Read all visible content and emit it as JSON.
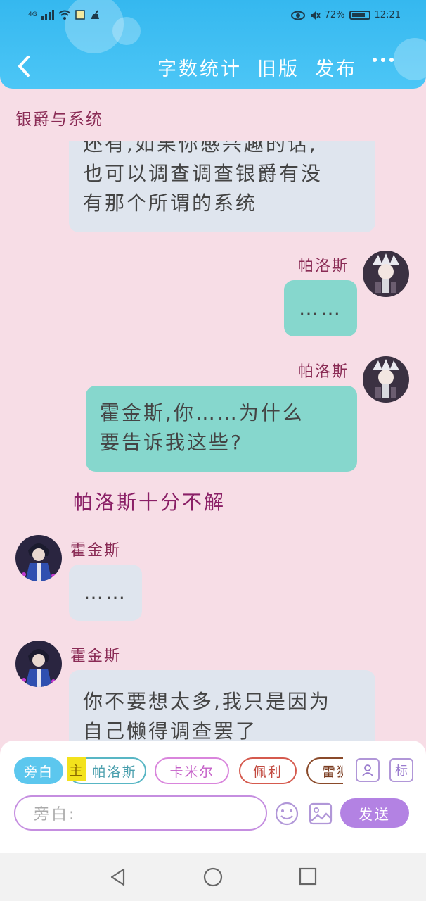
{
  "status_bar": {
    "network": "4G",
    "battery_percent": "72%",
    "time": "12:21"
  },
  "nav": {
    "actions": [
      "字数统计",
      "旧版",
      "发布"
    ]
  },
  "chat": {
    "title": "银爵与系统",
    "messages": [
      {
        "side": "left",
        "lines": [
          "还有,如果你感兴趣的话,",
          "也可以调查调查银爵有没",
          "有那个所谓的系统"
        ]
      },
      {
        "side": "right",
        "sender": "帕洛斯",
        "lines": [
          "……"
        ]
      },
      {
        "side": "right",
        "sender": "帕洛斯",
        "lines": [
          "霍金斯,你……为什么",
          "要告诉我这些?"
        ]
      },
      {
        "side": "narration",
        "text": "帕洛斯十分不解"
      },
      {
        "side": "left",
        "sender": "霍金斯",
        "lines": [
          "……"
        ]
      },
      {
        "side": "left",
        "sender": "霍金斯",
        "lines": [
          "你不要想太多,我只是因为",
          "自己懒得调查罢了"
        ]
      }
    ]
  },
  "panel": {
    "chips": {
      "narration": "旁白",
      "main_mark": "主",
      "c1": "帕洛斯",
      "c2": "卡米尔",
      "c3": "佩利",
      "c4": "雷狮"
    },
    "tag_icon_label": "标",
    "input_placeholder": "旁白:",
    "send_label": "发送"
  },
  "colors": {
    "header": "#35b8ef",
    "background": "#f7dde6",
    "bubble_gray": "#dfe5ee",
    "bubble_teal": "#86d7cd",
    "name_color": "#8a2b55",
    "send_button": "#b382e3"
  }
}
